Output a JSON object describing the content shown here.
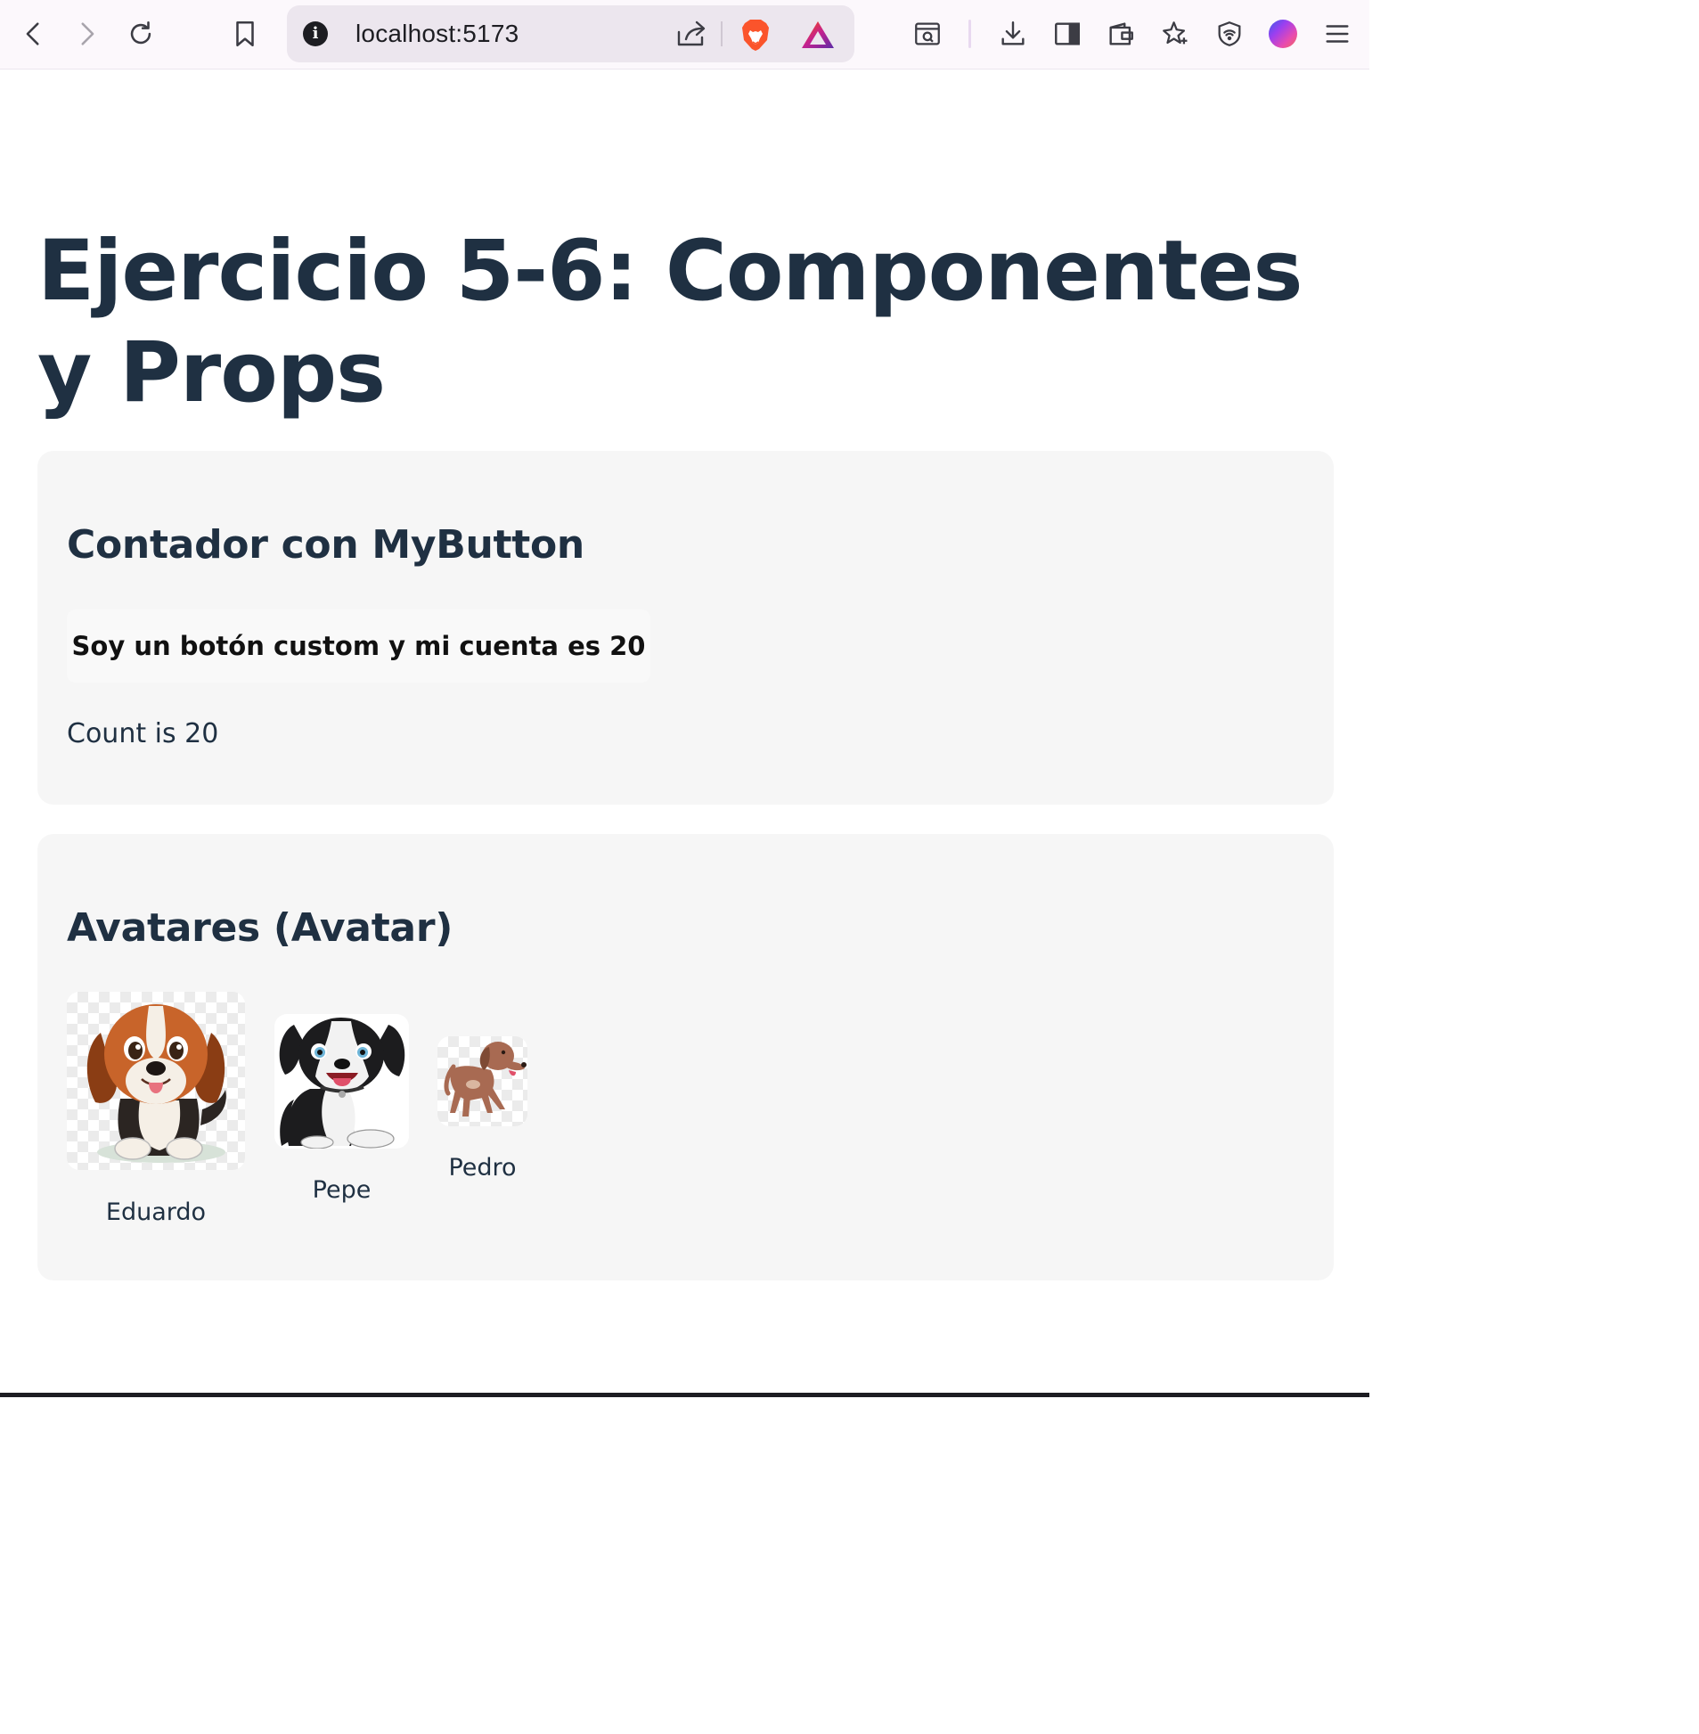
{
  "browser": {
    "url": "localhost:5173",
    "icons": {
      "back": "chevron-left-icon",
      "forward": "chevron-right-icon",
      "reload": "reload-icon",
      "bookmark": "bookmark-icon",
      "site_info": "info-icon",
      "share": "share-icon",
      "brave_shields": "brave-lion-icon",
      "rewards": "brave-rewards-icon",
      "screenshot": "screenshot-search-icon",
      "downloads": "download-icon",
      "sidebar": "sidebar-icon",
      "wallet": "wallet-icon",
      "leo": "leo-ai-icon",
      "vpn": "vpn-shield-icon",
      "profile": "profile-avatar",
      "menu": "hamburger-menu-icon"
    },
    "colors": {
      "toolbar_bg": "#fcf8fc",
      "urlbar_bg": "#ece6ee",
      "brave_orange": "#fb542b"
    }
  },
  "page": {
    "title": "Ejercicio 5-6: Componentes y Props",
    "text_color": "#1f3042",
    "card_bg": "#f6f6f6"
  },
  "counter_section": {
    "heading": "Contador con MyButton",
    "button_label": "Soy un botón custom y mi cuenta es 20",
    "count_text": "Count is 20"
  },
  "avatars_section": {
    "heading": "Avatares (Avatar)",
    "avatars": [
      {
        "name": "Eduardo",
        "image": "beagle-puppy-illustration"
      },
      {
        "name": "Pepe",
        "image": "black-white-puppy-illustration"
      },
      {
        "name": "Pedro",
        "image": "brown-dog-illustration"
      }
    ]
  }
}
